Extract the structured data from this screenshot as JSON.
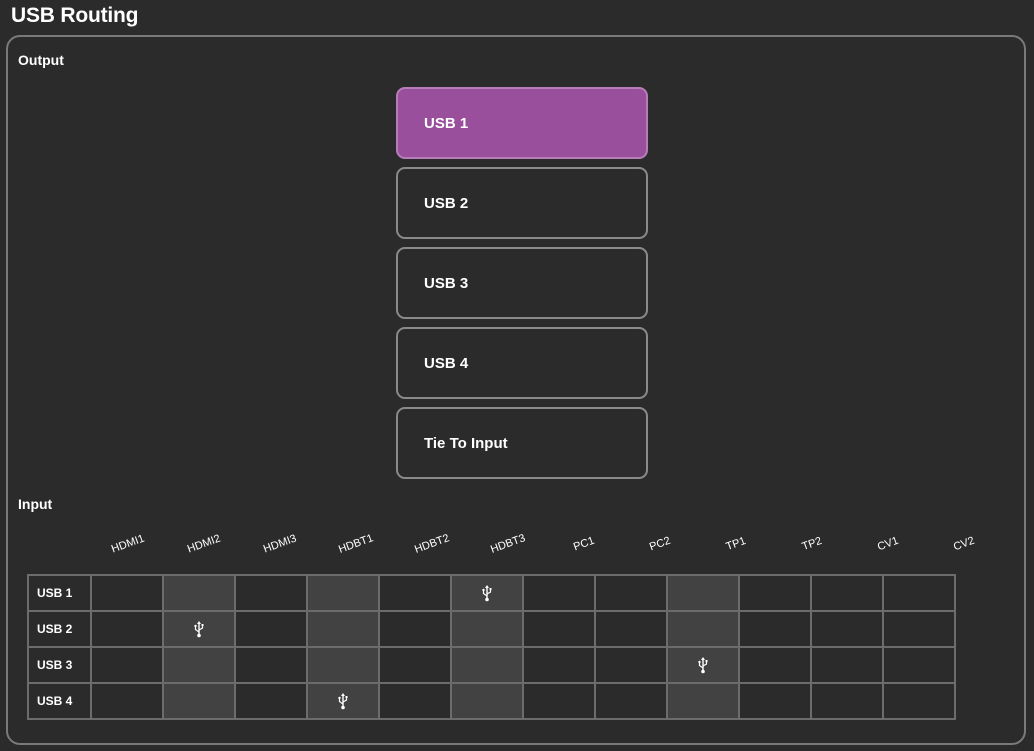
{
  "page": {
    "title": "USB Routing"
  },
  "output": {
    "label": "Output",
    "buttons": [
      {
        "label": "USB 1",
        "selected": true
      },
      {
        "label": "USB 2",
        "selected": false
      },
      {
        "label": "USB 3",
        "selected": false
      },
      {
        "label": "USB 4",
        "selected": false
      },
      {
        "label": "Tie To Input",
        "selected": false
      }
    ]
  },
  "input": {
    "label": "Input",
    "columns": [
      "HDMI1",
      "HDMI2",
      "HDMI3",
      "HDBT1",
      "HDBT2",
      "HDBT3",
      "PC1",
      "PC2",
      "TP1",
      "TP2",
      "CV1",
      "CV2"
    ],
    "shaded_columns": [
      1,
      3,
      5,
      8
    ],
    "rows": [
      {
        "label": "USB 1",
        "routed_column": 5
      },
      {
        "label": "USB 2",
        "routed_column": 1
      },
      {
        "label": "USB 3",
        "routed_column": 8
      },
      {
        "label": "USB 4",
        "routed_column": 3
      }
    ],
    "route_icon": "usb-icon"
  },
  "colors": {
    "background": "#2b2b2b",
    "selected_button": "#9a4f9d",
    "shaded_column": "#424242",
    "grid_line": "#6c6c6c"
  }
}
